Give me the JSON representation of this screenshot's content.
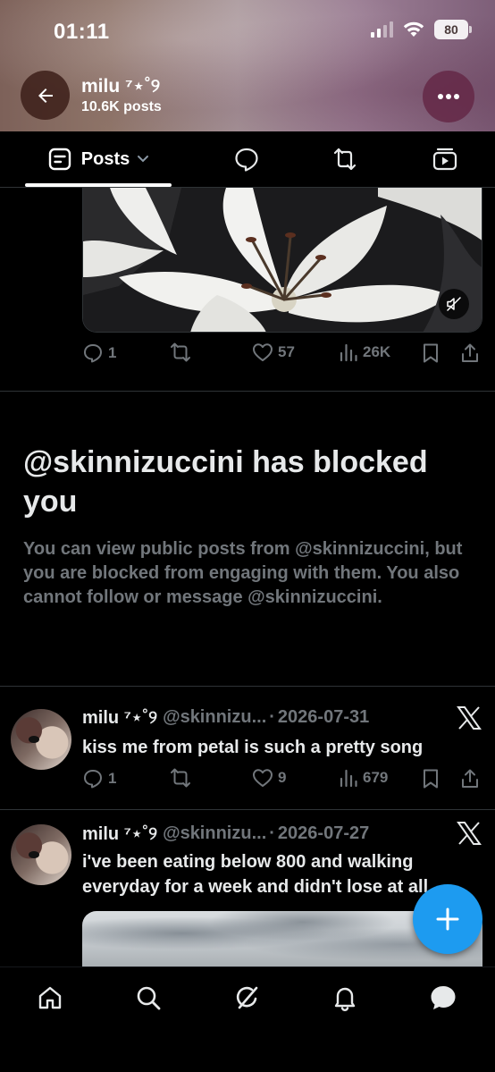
{
  "status_bar": {
    "time": "01:11",
    "battery": "80"
  },
  "profile": {
    "name": "milu ⁷⋆˚୨",
    "posts_count": "10.6K posts"
  },
  "tabs": {
    "posts_label": "Posts"
  },
  "post1": {
    "replies": "1",
    "likes": "57",
    "views": "26K"
  },
  "blocked": {
    "title": "@skinnizuccini has blocked you",
    "description": "You can view public posts from @skinnizuccini, but you are blocked from engaging with them. You also cannot follow or message @skinnizuccini."
  },
  "tweets": [
    {
      "name": "milu ⁷⋆˚୨",
      "handle": "@skinnizu...",
      "separator": "·",
      "date": "2026-07-31",
      "text": "kiss me from petal is such a pretty song",
      "replies": "1",
      "likes": "9",
      "views": "679"
    },
    {
      "name": "milu ⁷⋆˚୨",
      "handle": "@skinnizu...",
      "separator": "·",
      "date": "2026-07-27",
      "text": "i've been eating below 800 and walking everyday for a week and didn't lose at all"
    }
  ],
  "colors": {
    "accent": "#1d9bf0",
    "muted_text": "#71767b",
    "border": "#2f3336"
  },
  "icons": {
    "back": "arrow-left-icon",
    "more": "more-icon",
    "posts_tab": "posts-icon",
    "replies_tab": "chat-bubble-icon",
    "reposts_tab": "repost-icon",
    "media_tab": "media-icon",
    "mute": "muted-speaker-icon",
    "x": "x-logo-icon",
    "fab": "plus-icon",
    "nav": [
      "home-icon",
      "search-icon",
      "grok-icon",
      "bell-icon",
      "messages-icon"
    ]
  }
}
